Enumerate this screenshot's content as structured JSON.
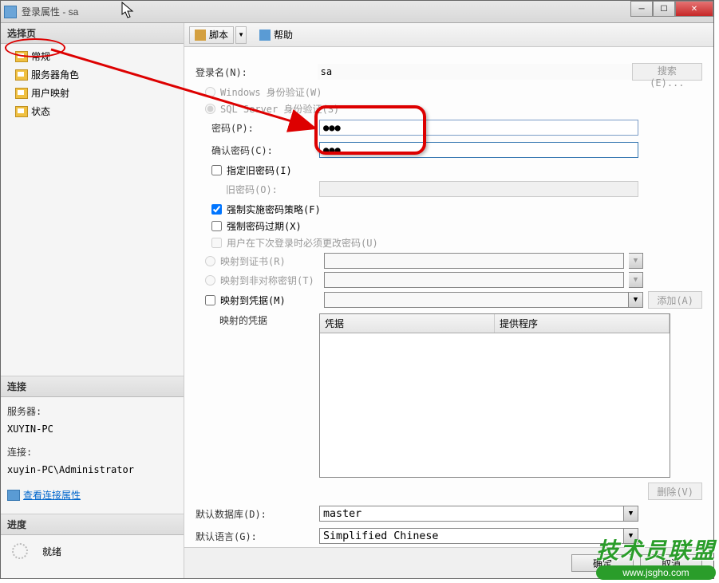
{
  "window": {
    "title": "登录属性 - sa"
  },
  "sidebar": {
    "select_header": "选择页",
    "pages": [
      {
        "label": "常规"
      },
      {
        "label": "服务器角色"
      },
      {
        "label": "用户映射"
      },
      {
        "label": "状态"
      }
    ],
    "conn_header": "连接",
    "conn": {
      "server_label": "服务器:",
      "server_value": "XUYIN-PC",
      "conn_label": "连接:",
      "conn_value": "xuyin-PC\\Administrator",
      "view_link": "查看连接属性"
    },
    "progress_header": "进度",
    "progress_status": "就绪"
  },
  "toolbar": {
    "script": "脚本",
    "help": "帮助"
  },
  "form": {
    "login_name_label": "登录名(N):",
    "login_name_value": "sa",
    "search_btn": "搜索(E)...",
    "auth_windows": "Windows 身份验证(W)",
    "auth_sql": "SQL Server 身份验证(S)",
    "password_label": "密码(P):",
    "password_value": "●●●",
    "confirm_label": "确认密码(C):",
    "confirm_value": "●●●",
    "specify_old": "指定旧密码(I)",
    "old_pwd_label": "旧密码(O):",
    "enforce_policy": "强制实施密码策略(F)",
    "enforce_expire": "强制密码过期(X)",
    "must_change": "用户在下次登录时必须更改密码(U)",
    "map_cert": "映射到证书(R)",
    "map_key": "映射到非对称密钥(T)",
    "map_cred": "映射到凭据(M)",
    "add_btn": "添加(A)",
    "mapped_creds": "映射的凭据",
    "col_cred": "凭据",
    "col_provider": "提供程序",
    "remove_btn": "删除(V)",
    "default_db_label": "默认数据库(D):",
    "default_db_value": "master",
    "default_lang_label": "默认语言(G):",
    "default_lang_value": "Simplified Chinese"
  },
  "buttons": {
    "ok": "确定",
    "cancel": "取消"
  },
  "watermark": {
    "text": "技术员联盟",
    "url": "www.jsgho.com"
  }
}
